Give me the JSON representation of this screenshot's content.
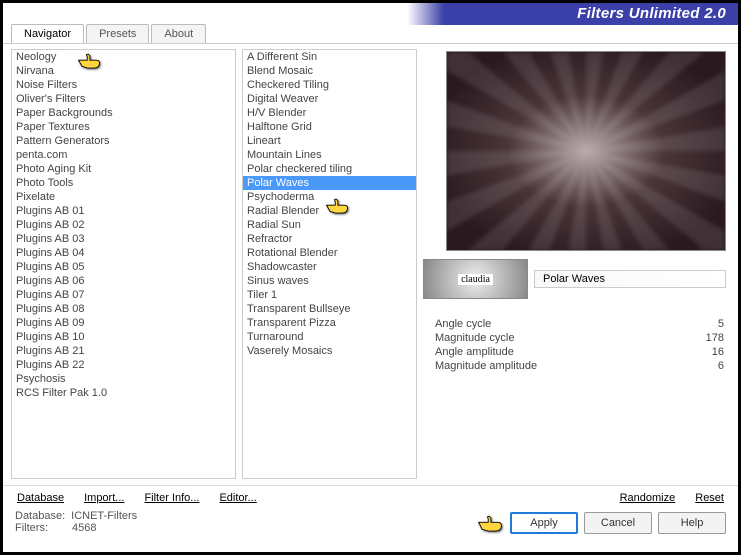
{
  "title": "Filters Unlimited 2.0",
  "tabs": [
    "Navigator",
    "Presets",
    "About"
  ],
  "active_tab": 0,
  "categories": [
    "Neology",
    "Nirvana",
    "Noise Filters",
    "Oliver's Filters",
    "Paper Backgrounds",
    "Paper Textures",
    "Pattern Generators",
    "penta.com",
    "Photo Aging Kit",
    "Photo Tools",
    "Pixelate",
    "Plugins AB 01",
    "Plugins AB 02",
    "Plugins AB 03",
    "Plugins AB 04",
    "Plugins AB 05",
    "Plugins AB 06",
    "Plugins AB 07",
    "Plugins AB 08",
    "Plugins AB 09",
    "Plugins AB 10",
    "Plugins AB 21",
    "Plugins AB 22",
    "Psychosis",
    "RCS Filter Pak 1.0"
  ],
  "filters": [
    "A Different Sin",
    "Blend Mosaic",
    "Checkered Tiling",
    "Digital Weaver",
    "H/V Blender",
    "Halftone Grid",
    "Lineart",
    "Mountain Lines",
    "Polar checkered tiling",
    "Polar Waves",
    "Psychoderma",
    "Radial Blender",
    "Radial Sun",
    "Refractor",
    "Rotational Blender",
    "Shadowcaster",
    "Sinus waves",
    "Tiler 1",
    "Transparent Bullseye",
    "Transparent Pizza",
    "Turnaround",
    "Vaserely Mosaics"
  ],
  "selected_filter_index": 9,
  "logo_text": "claudia",
  "current_filter_name": "Polar Waves",
  "params": [
    {
      "label": "Angle cycle",
      "value": "5"
    },
    {
      "label": "Magnitude cycle",
      "value": "178"
    },
    {
      "label": "Angle amplitude",
      "value": "16"
    },
    {
      "label": "Magnitude amplitude",
      "value": "6"
    }
  ],
  "toolbar": {
    "database": "Database",
    "import": "Import...",
    "filter_info": "Filter Info...",
    "editor": "Editor...",
    "randomize": "Randomize",
    "reset": "Reset"
  },
  "status": {
    "db_label": "Database:",
    "db_value": "ICNET-Filters",
    "filters_label": "Filters:",
    "filters_value": "4568"
  },
  "buttons": {
    "apply": "Apply",
    "cancel": "Cancel",
    "help": "Help"
  }
}
